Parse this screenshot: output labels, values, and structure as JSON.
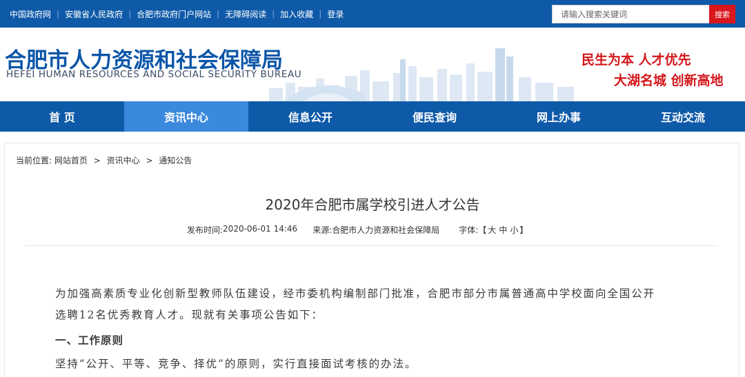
{
  "topbar": {
    "links": [
      "中国政府网",
      "安徽省人民政府",
      "合肥市政府门户网站",
      "无障碍阅读",
      "加入收藏",
      "登录"
    ],
    "search_placeholder": "请输入搜索关键词",
    "search_button": "搜索"
  },
  "header": {
    "org_name_cn": "合肥市人力资源和社会保障局",
    "org_name_en": "HEFEI HUMAN RESOURCES AND SOCIAL SECURITY BUREAU",
    "slogan_line1": "民生为本  人才优先",
    "slogan_line2": "大湖名城  创新高地"
  },
  "nav": {
    "items": [
      "首  页",
      "资讯中心",
      "信息公开",
      "便民查询",
      "网上办事",
      "互动交流"
    ],
    "active": "资讯中心"
  },
  "breadcrumb": {
    "prefix": "当前位置:",
    "items": [
      "网站首页",
      "资讯中心",
      "通知公告"
    ],
    "separator": ">"
  },
  "article": {
    "title": "2020年合肥市属学校引进人才公告",
    "publish_label": "发布时间:",
    "publish_time": "2020-06-01 14:46",
    "source_label": "来源:",
    "source": "合肥市人力资源和社会保障局",
    "font_label": "字体:",
    "font_open": "【",
    "font_sizes": [
      "大",
      "中",
      "小"
    ],
    "font_close": "】",
    "paragraph1_line1": "为加强高素质专业化创新型教师队伍建设，经市委机构编制部门批准，合肥市部分市属普通高中学校面向全国公开",
    "paragraph1_line2": "选聘12名优秀教育人才。现就有关事项公告如下：",
    "section1_heading": "一、工作原则",
    "paragraph2": "坚持“公开、平等、竞争、择优”的原则，实行直接面试考核的办法。"
  },
  "colors": {
    "brand_blue": "#0f5aa8",
    "nav_active": "#3a89dd",
    "slogan_red": "#d4161b",
    "search_red": "#d9161c"
  }
}
